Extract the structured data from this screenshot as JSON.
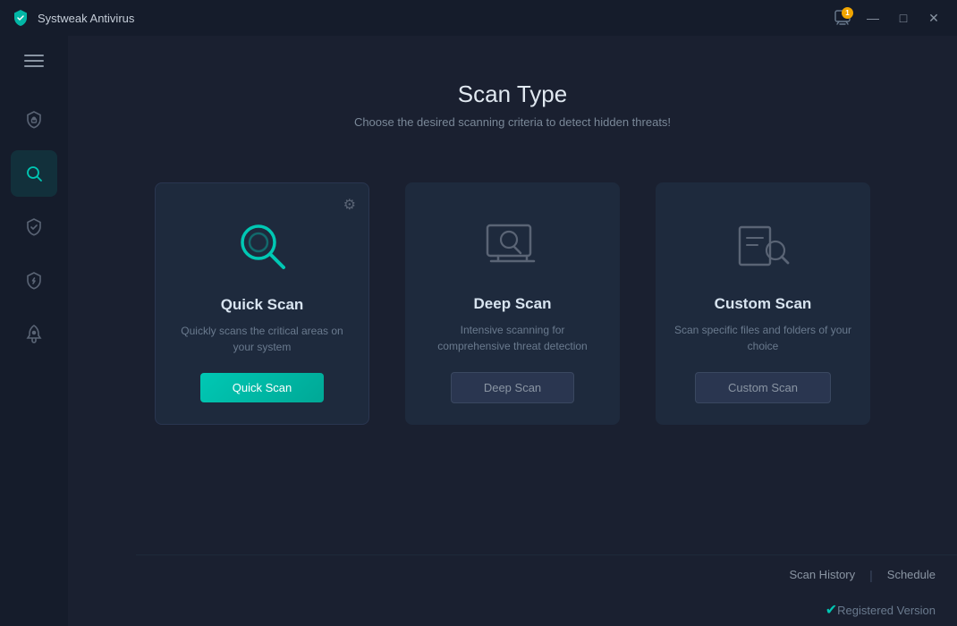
{
  "titleBar": {
    "appTitle": "Systweak Antivirus",
    "notifCount": "1",
    "btnMinimize": "—",
    "btnMaximize": "□",
    "btnClose": "✕"
  },
  "sidebar": {
    "items": [
      {
        "id": "protection",
        "label": "Protection",
        "iconType": "shield-lock"
      },
      {
        "id": "scan",
        "label": "Scan",
        "iconType": "search",
        "active": true
      },
      {
        "id": "check",
        "label": "Check",
        "iconType": "shield-check"
      },
      {
        "id": "security",
        "label": "Security",
        "iconType": "shield-bolt"
      },
      {
        "id": "boost",
        "label": "Boost",
        "iconType": "rocket"
      }
    ]
  },
  "page": {
    "title": "Scan Type",
    "subtitle": "Choose the desired scanning criteria to detect hidden threats!"
  },
  "scanCards": [
    {
      "id": "quick",
      "title": "Quick Scan",
      "description": "Quickly scans the critical areas on your system",
      "buttonLabel": "Quick Scan",
      "buttonType": "primary",
      "hasGear": true,
      "active": true
    },
    {
      "id": "deep",
      "title": "Deep Scan",
      "description": "Intensive scanning for comprehensive threat detection",
      "buttonLabel": "Deep Scan",
      "buttonType": "secondary",
      "hasGear": false,
      "active": false
    },
    {
      "id": "custom",
      "title": "Custom Scan",
      "description": "Scan specific files and folders of your choice",
      "buttonLabel": "Custom Scan",
      "buttonType": "secondary",
      "hasGear": false,
      "active": false
    }
  ],
  "footer": {
    "scanHistoryLabel": "Scan History",
    "separatorLabel": "|",
    "scheduleLabel": "Schedule",
    "registeredLabel": "Registered Version"
  }
}
